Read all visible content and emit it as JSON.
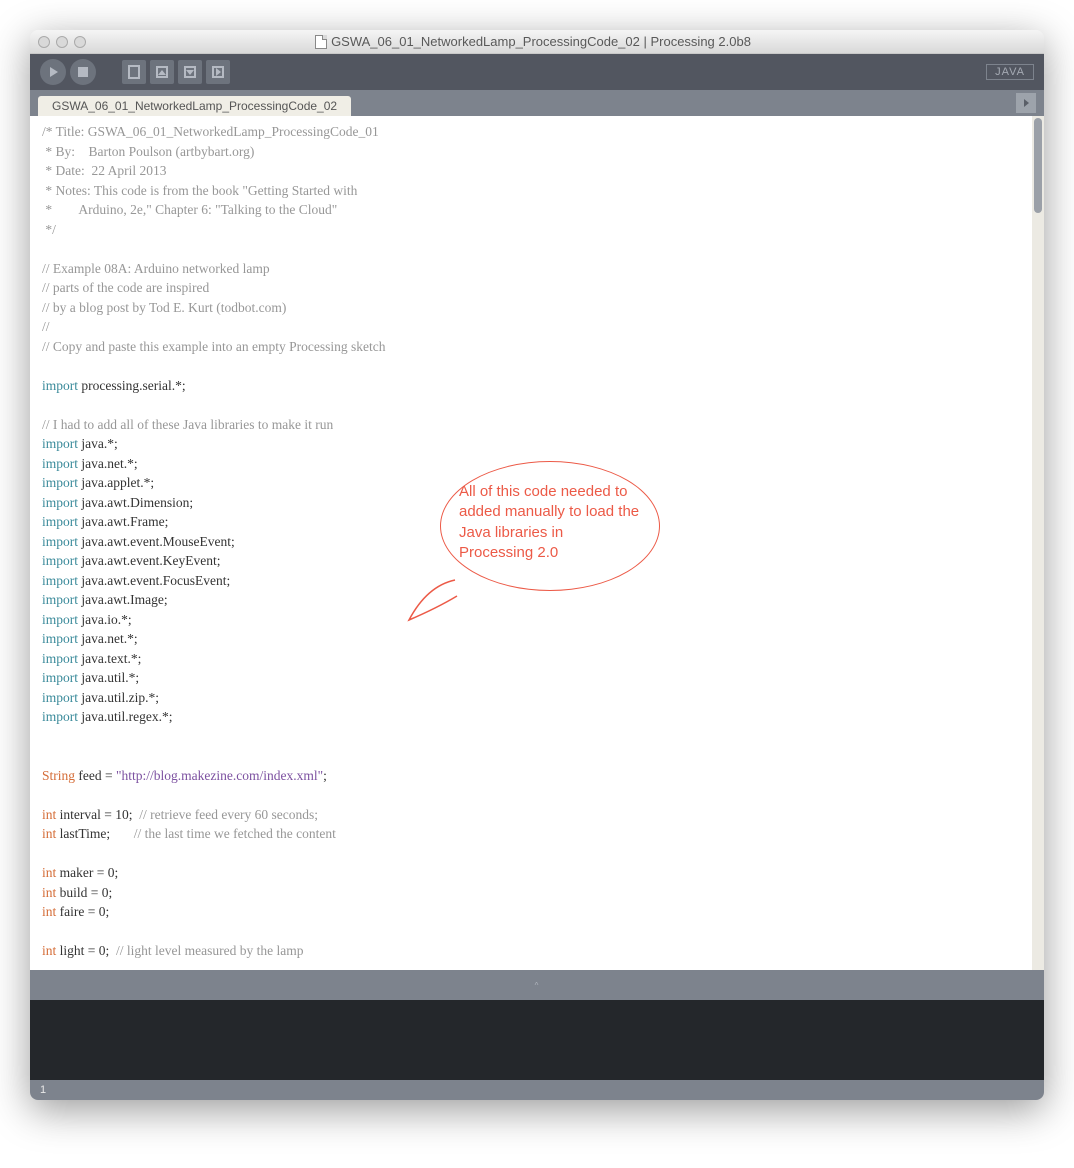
{
  "titlebar": {
    "title": "GSWA_06_01_NetworkedLamp_ProcessingCode_02 | Processing 2.0b8"
  },
  "toolbar": {
    "mode_badge": "JAVA"
  },
  "tabs": {
    "active": "GSWA_06_01_NetworkedLamp_ProcessingCode_02"
  },
  "code": {
    "lines": [
      {
        "t": "comment",
        "s": "/* Title: GSWA_06_01_NetworkedLamp_ProcessingCode_01"
      },
      {
        "t": "comment",
        "s": " * By:    Barton Poulson (artbybart.org)"
      },
      {
        "t": "comment",
        "s": " * Date:  22 April 2013"
      },
      {
        "t": "comment",
        "s": " * Notes: This code is from the book \"Getting Started with"
      },
      {
        "t": "comment",
        "s": " *        Arduino, 2e,\" Chapter 6: \"Talking to the Cloud\""
      },
      {
        "t": "comment",
        "s": " */"
      },
      {
        "t": "blank",
        "s": ""
      },
      {
        "t": "comment",
        "s": "// Example 08A: Arduino networked lamp"
      },
      {
        "t": "comment",
        "s": "// parts of the code are inspired"
      },
      {
        "t": "comment",
        "s": "// by a blog post by Tod E. Kurt (todbot.com)"
      },
      {
        "t": "comment",
        "s": "//"
      },
      {
        "t": "comment",
        "s": "// Copy and paste this example into an empty Processing sketch"
      },
      {
        "t": "blank",
        "s": ""
      },
      {
        "t": "import",
        "k": "import",
        "r": " processing.serial.*;"
      },
      {
        "t": "blank",
        "s": ""
      },
      {
        "t": "comment",
        "s": "// I had to add all of these Java libraries to make it run"
      },
      {
        "t": "import",
        "k": "import",
        "r": " java.*;"
      },
      {
        "t": "import",
        "k": "import",
        "r": " java.net.*;"
      },
      {
        "t": "import",
        "k": "import",
        "r": " java.applet.*;"
      },
      {
        "t": "import",
        "k": "import",
        "r": " java.awt.Dimension;"
      },
      {
        "t": "import",
        "k": "import",
        "r": " java.awt.Frame;"
      },
      {
        "t": "import",
        "k": "import",
        "r": " java.awt.event.MouseEvent;"
      },
      {
        "t": "import",
        "k": "import",
        "r": " java.awt.event.KeyEvent;"
      },
      {
        "t": "import",
        "k": "import",
        "r": " java.awt.event.FocusEvent;"
      },
      {
        "t": "import",
        "k": "import",
        "r": " java.awt.Image;"
      },
      {
        "t": "import",
        "k": "import",
        "r": " java.io.*;"
      },
      {
        "t": "import",
        "k": "import",
        "r": " java.net.*;"
      },
      {
        "t": "import",
        "k": "import",
        "r": " java.text.*;"
      },
      {
        "t": "import",
        "k": "import",
        "r": " java.util.*;"
      },
      {
        "t": "import",
        "k": "import",
        "r": " java.util.zip.*;"
      },
      {
        "t": "import",
        "k": "import",
        "r": " java.util.regex.*;"
      },
      {
        "t": "blank",
        "s": ""
      },
      {
        "t": "blank",
        "s": ""
      },
      {
        "t": "decl",
        "ty": "String",
        "n": " feed = ",
        "str": "\"http://blog.makezine.com/index.xml\"",
        "tail": ";"
      },
      {
        "t": "blank",
        "s": ""
      },
      {
        "t": "decl",
        "ty": "int",
        "n": " interval = 10;  ",
        "cm": "// retrieve feed every 60 seconds;"
      },
      {
        "t": "decl",
        "ty": "int",
        "n": " lastTime;       ",
        "cm": "// the last time we fetched the content"
      },
      {
        "t": "blank",
        "s": ""
      },
      {
        "t": "decl",
        "ty": "int",
        "n": " maker = 0;"
      },
      {
        "t": "decl",
        "ty": "int",
        "n": " build = 0;"
      },
      {
        "t": "decl",
        "ty": "int",
        "n": " faire = 0;"
      },
      {
        "t": "blank",
        "s": ""
      },
      {
        "t": "decl",
        "ty": "int",
        "n": " light = 0;  ",
        "cm": "// light level measured by the lamp"
      }
    ]
  },
  "annotation": {
    "text": "All of this code needed to added manually  to load the Java libraries in Processing 2.0"
  },
  "statusbar": {
    "line": "1"
  },
  "colors": {
    "comment": "#979797",
    "keyword": "#3a8a9a",
    "type": "#d46b35",
    "string": "#7c50a0",
    "annotation": "#ec5a47",
    "toolbar_bg": "#525660",
    "tabbar_bg": "#7d838d"
  }
}
